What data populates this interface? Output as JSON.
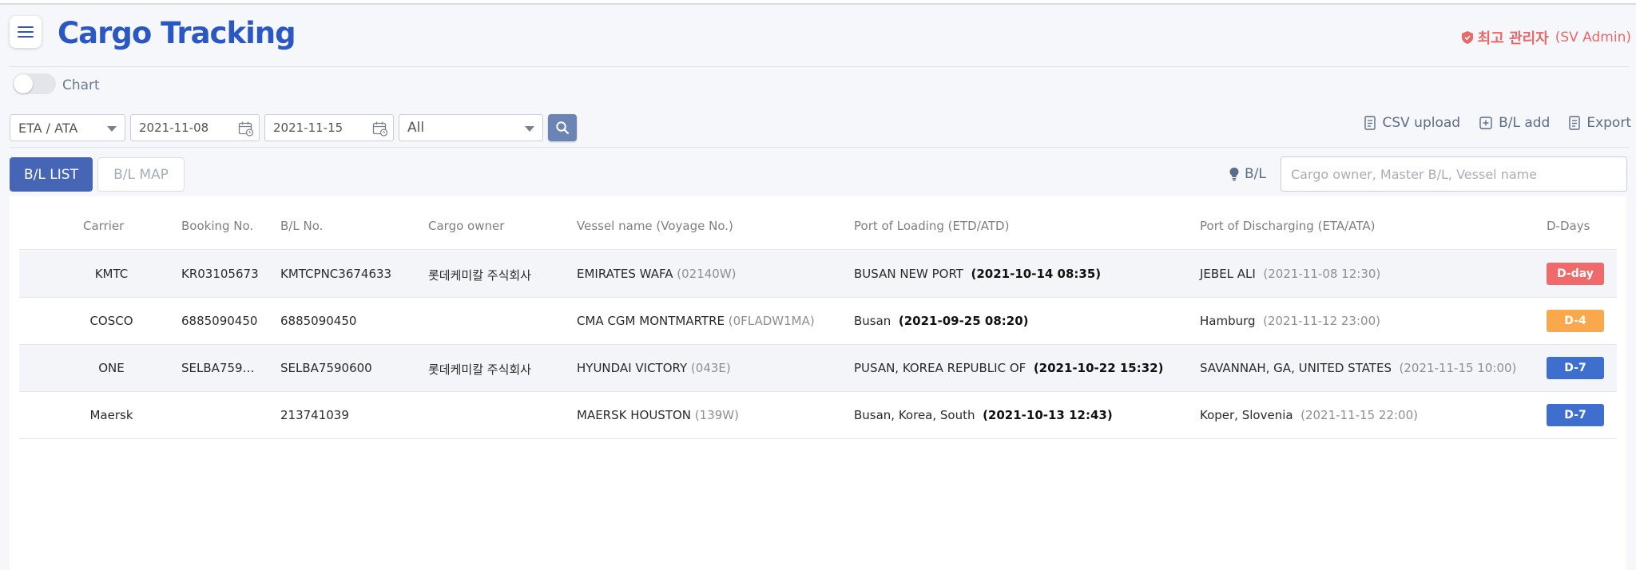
{
  "header": {
    "title": "Cargo Tracking",
    "role": "최고 관리자",
    "role_en": "(SV Admin)"
  },
  "chart_toggle": {
    "label": "Chart",
    "on": false
  },
  "filters": {
    "date_type": "ETA / ATA",
    "date_from": "2021-11-08",
    "date_to": "2021-11-15",
    "category": "All"
  },
  "actions": {
    "csv_upload": "CSV upload",
    "bl_add": "B/L add",
    "export": "Export"
  },
  "tabs": {
    "list": "B/L LIST",
    "map": "B/L MAP"
  },
  "bl_search": {
    "label": "B/L",
    "placeholder": "Cargo owner, Master B/L, Vessel name"
  },
  "table": {
    "columns": [
      "Carrier",
      "Booking No.",
      "B/L No.",
      "Cargo owner",
      "Vessel name (Voyage No.)",
      "Port of Loading (ETD/ATD)",
      "Port of Discharging (ETA/ATA)",
      "D-Days"
    ],
    "rows": [
      {
        "carrier": "KMTC",
        "booking": "KR03105673",
        "bl": "KMTCPNC3674633",
        "owner": "롯데케미칼 주식회사",
        "vessel": "EMIRATES WAFA",
        "voyage": "(02140W)",
        "pol": "BUSAN NEW PORT",
        "etd": "(2021-10-14 08:35)",
        "pod": "JEBEL ALI",
        "eta": "(2021-11-08 12:30)",
        "dday": "D-day",
        "dday_color": "#ef6b6b"
      },
      {
        "carrier": "COSCO",
        "booking": "6885090450",
        "bl": "6885090450",
        "owner": "",
        "vessel": "CMA CGM MONTMARTRE",
        "voyage": "(0FLADW1MA)",
        "pol": "Busan",
        "etd": "(2021-09-25 08:20)",
        "pod": "Hamburg",
        "eta": "(2021-11-12 23:00)",
        "dday": "D-4",
        "dday_color": "#f9a94b"
      },
      {
        "carrier": "ONE",
        "booking": "SELBA759…",
        "bl": "SELBA7590600",
        "owner": "롯데케미칼 주식회사",
        "vessel": "HYUNDAI VICTORY",
        "voyage": "(043E)",
        "pol": "PUSAN, KOREA REPUBLIC OF",
        "etd": "(2021-10-22 15:32)",
        "pod": "SAVANNAH, GA, UNITED STATES",
        "eta": "(2021-11-15 10:00)",
        "dday": "D-7",
        "dday_color": "#3f6fce"
      },
      {
        "carrier": "Maersk",
        "booking": "",
        "bl": "213741039",
        "owner": "",
        "vessel": "MAERSK HOUSTON",
        "voyage": "(139W)",
        "pol": "Busan, Korea, South",
        "etd": "(2021-10-13 12:43)",
        "pod": "Koper, Slovenia",
        "eta": "(2021-11-15 22:00)",
        "dday": "D-7",
        "dday_color": "#3f6fce"
      }
    ]
  }
}
